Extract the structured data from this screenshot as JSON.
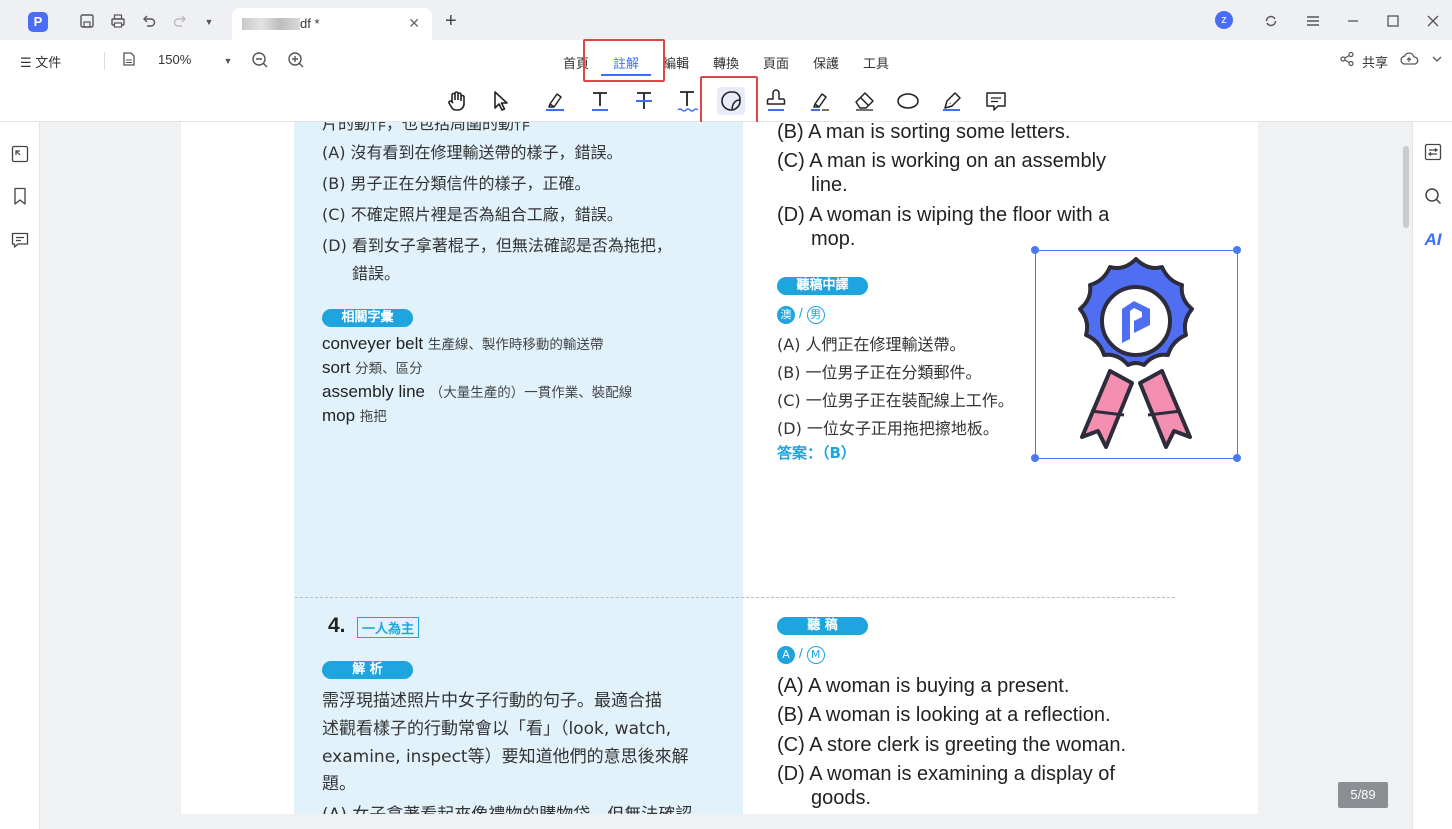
{
  "titlebar": {
    "tab_title": "df *",
    "colors": {
      "accent": "#4a6cf7"
    },
    "avatar_letter": "z"
  },
  "menubar": {
    "file_label": "文件",
    "zoom": "150%",
    "tabs": [
      {
        "label": "首頁",
        "active": false
      },
      {
        "label": "註解",
        "active": true
      },
      {
        "label": "編輯",
        "active": false
      },
      {
        "label": "轉換",
        "active": false
      },
      {
        "label": "頁面",
        "active": false
      },
      {
        "label": "保護",
        "active": false
      },
      {
        "label": "工具",
        "active": false
      }
    ],
    "share_label": "共享"
  },
  "toolbar": {
    "tools": [
      "hand-icon",
      "select-cursor-icon",
      "highlight-icon",
      "underline-icon",
      "strikethrough-icon",
      "squiggly-icon",
      "sticker-icon",
      "stamp-icon",
      "area-highlight-icon",
      "eraser-icon",
      "ellipse-icon",
      "pen-icon",
      "text-box-icon"
    ],
    "selected_tool": "sticker-icon"
  },
  "document": {
    "left_top": {
      "cut_line": "片的動作，也包括周圍的動作",
      "options": [
        "(A) 沒有看到在修理輸送帶的樣子，錯誤。",
        "(B) 男子正在分類信件的樣子，正確。",
        "(C) 不確定照片裡是否為組合工廠，錯誤。",
        "(D) 看到女子拿著棍子，但無法確認是否為拖把，",
        "錯誤。"
      ],
      "vocab_title": "相關字彙",
      "vocab": [
        {
          "en": "conveyer belt",
          "zh": "生產線、製作時移動的輸送帶"
        },
        {
          "en": "sort",
          "zh": "分類、區分"
        },
        {
          "en": "assembly line",
          "zh": "（大量生產的）一貫作業、裝配線"
        },
        {
          "en": "mop",
          "zh": "拖把"
        }
      ]
    },
    "right_top": {
      "options_en": [
        "(B) A man is sorting some letters.",
        "(C) A man is working on an assembly",
        "line.",
        "(D) A woman is wiping the floor with a",
        "mop."
      ],
      "translation_title": "聽稿中譯",
      "speakers": [
        "澳",
        "男"
      ],
      "options_zh": [
        "(A) 人們正在修理輸送帶。",
        "(B) 一位男子正在分類郵件。",
        "(C) 一位男子正在裝配線上工作。",
        "(D) 一位女子正用拖把擦地板。"
      ],
      "answer": "答案：（B）"
    },
    "left_bottom": {
      "number": "4.",
      "tag": "一人為主",
      "analysis_title": "解 析",
      "analysis": [
        "需浮現描述照片中女子行動的句子。最適合描",
        "述觀看樣子的行動常會以「看」（look, watch,",
        "examine, inspect等）要知道他們的意思後來解",
        "題。",
        "(A) 女子拿著看起來像禮物的購物袋，但無法確認"
      ]
    },
    "right_bottom": {
      "script_title": "聽 稿",
      "speakers": [
        "A",
        "M"
      ],
      "options_en": [
        "(A) A woman is buying a present.",
        "(B) A woman is looking at a reflection.",
        "(C) A store clerk is greeting the woman.",
        "(D) A woman is examining a display of",
        "goods."
      ]
    }
  },
  "status": {
    "page_indicator": "5/89"
  }
}
